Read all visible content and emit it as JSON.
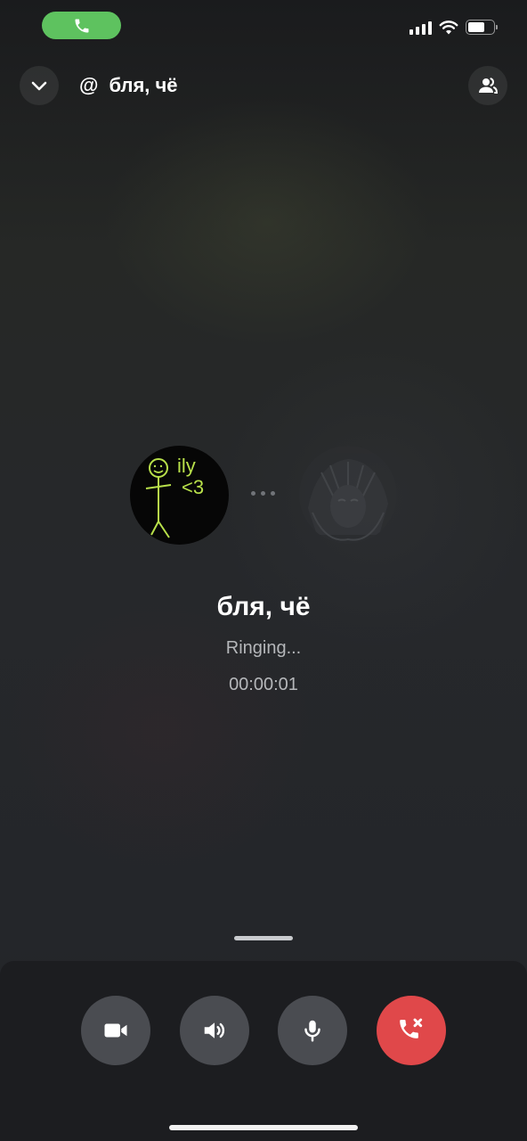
{
  "status_bar": {
    "icons": [
      "phone-icon",
      "cellular-signal-icon",
      "wifi-icon",
      "battery-icon"
    ],
    "call_pill_color": "#5ec25f",
    "battery_level": 0.65
  },
  "header": {
    "back_icon": "chevron-down-icon",
    "channel_icon": "at-icon",
    "at_symbol": "@",
    "title": "бля, чё",
    "members_icon": "members-icon"
  },
  "call": {
    "name": "бля, чё",
    "status": "Ringing...",
    "timer": "00:00:01",
    "self_avatar_text_top": "ily",
    "self_avatar_text_bottom": "<3"
  },
  "controls": {
    "video_icon": "video-camera-icon",
    "speaker_icon": "speaker-icon",
    "mic_icon": "microphone-icon",
    "end_icon": "end-call-icon",
    "end_color": "#e0484a",
    "button_color": "#4a4c51"
  }
}
